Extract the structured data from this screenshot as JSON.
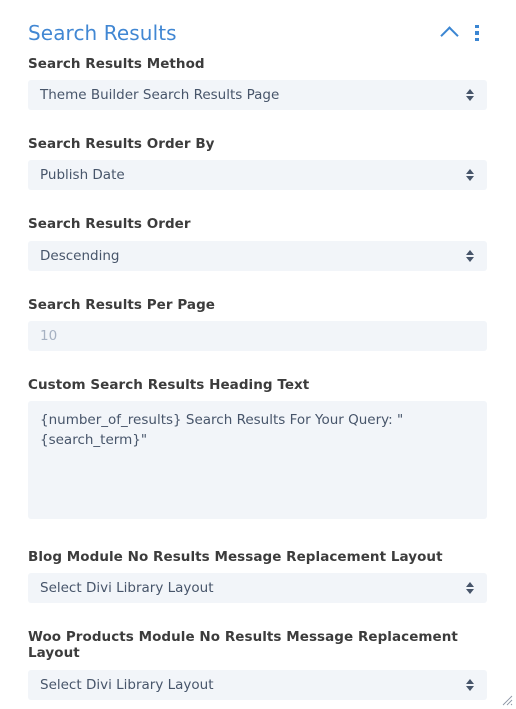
{
  "header": {
    "title": "Search Results",
    "collapse_icon": "chevron-up-icon",
    "menu_icon": "kebab-menu-icon",
    "accent_color": "#4187d3"
  },
  "theme": {
    "field_background": "#f2f5f9",
    "field_text": "#47556a",
    "label_text": "#3c3c3c",
    "placeholder_text": "#a6b1c2"
  },
  "fields": [
    {
      "label": "Search Results Method",
      "type": "select",
      "value": "Theme Builder Search Results Page"
    },
    {
      "label": "Search Results Order By",
      "type": "select",
      "value": "Publish Date"
    },
    {
      "label": "Search Results Order",
      "type": "select",
      "value": "Descending"
    },
    {
      "label": "Search Results Per Page",
      "type": "text",
      "value": "",
      "placeholder": "10"
    },
    {
      "label": "Custom Search Results Heading Text",
      "type": "textarea",
      "value": "{number_of_results} Search Results For Your Query: \"{search_term}\""
    },
    {
      "label": "Blog Module No Results Message Replacement Layout",
      "type": "select",
      "value": "Select Divi Library Layout"
    },
    {
      "label": "Woo Products Module No Results Message Replacement Layout",
      "type": "select",
      "value": "Select Divi Library Layout"
    }
  ]
}
